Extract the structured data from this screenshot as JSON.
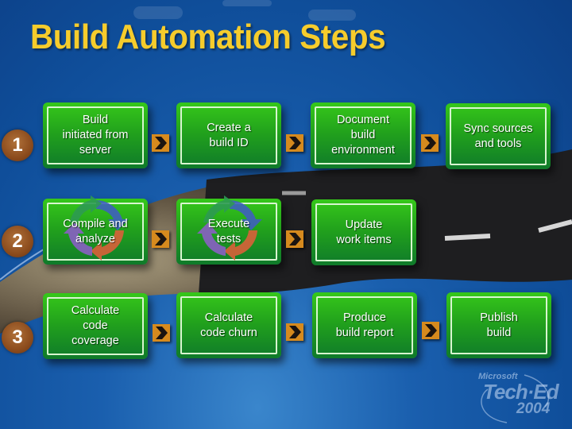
{
  "title": "Build Automation Steps",
  "rows": [
    {
      "number": "1",
      "steps": [
        {
          "label": "Build\ninitiated from\nserver",
          "icon": null
        },
        {
          "label": "Create a\nbuild ID",
          "icon": null
        },
        {
          "label": "Document\nbuild\nenvironment",
          "icon": null
        },
        {
          "label": "Sync sources\nand tools",
          "icon": null
        }
      ]
    },
    {
      "number": "2",
      "steps": [
        {
          "label": "Compile and\nanalyze",
          "icon": "cycle-arrows-icon"
        },
        {
          "label": "Execute\ntests",
          "icon": "cycle-arrows-icon"
        },
        {
          "label": "Update\nwork items",
          "icon": null
        }
      ]
    },
    {
      "number": "3",
      "steps": [
        {
          "label": "Calculate\ncode\ncoverage",
          "icon": null
        },
        {
          "label": "Calculate\ncode churn",
          "icon": null
        },
        {
          "label": "Produce\nbuild report",
          "icon": null
        },
        {
          "label": "Publish\nbuild",
          "icon": null
        }
      ]
    }
  ],
  "connector_icon": "chevron-right-sign-icon",
  "logo": {
    "brand": "Microsoft",
    "event": "Tech·Ed",
    "year": "2004"
  },
  "colors": {
    "title": "#f6cc2c",
    "step_top": "#36c81a",
    "step_bottom": "#0f7a2a",
    "number_badge": "#8c4c1d",
    "arrow_sign": "#d68a1e",
    "background": "#1a5fae",
    "road": "#1e1e20"
  }
}
